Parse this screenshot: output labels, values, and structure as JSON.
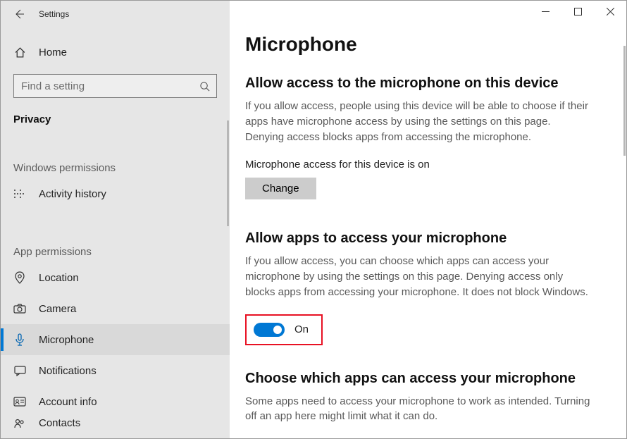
{
  "app": {
    "title": "Settings"
  },
  "nav": {
    "home": "Home",
    "search_placeholder": "Find a setting",
    "category": "Privacy",
    "group1": "Windows permissions",
    "group2": "App permissions",
    "items_g1": [
      {
        "label": "Activity history"
      }
    ],
    "items_g2": [
      {
        "label": "Location"
      },
      {
        "label": "Camera"
      },
      {
        "label": "Microphone"
      },
      {
        "label": "Notifications"
      },
      {
        "label": "Account info"
      },
      {
        "label": "Contacts"
      }
    ]
  },
  "main": {
    "title": "Microphone",
    "sect1_title": "Allow access to the microphone on this device",
    "sect1_desc": "If you allow access, people using this device will be able to choose if their apps have microphone access by using the settings on this page. Denying access blocks apps from accessing the microphone.",
    "sect1_status": "Microphone access for this device is on",
    "sect1_button": "Change",
    "sect2_title": "Allow apps to access your microphone",
    "sect2_desc": "If you allow access, you can choose which apps can access your microphone by using the settings on this page. Denying access only blocks apps from accessing your microphone. It does not block Windows.",
    "sect2_toggle": "On",
    "sect3_title": "Choose which apps can access your microphone",
    "sect3_desc": "Some apps need to access your microphone to work as intended. Turning off an app here might limit what it can do."
  }
}
